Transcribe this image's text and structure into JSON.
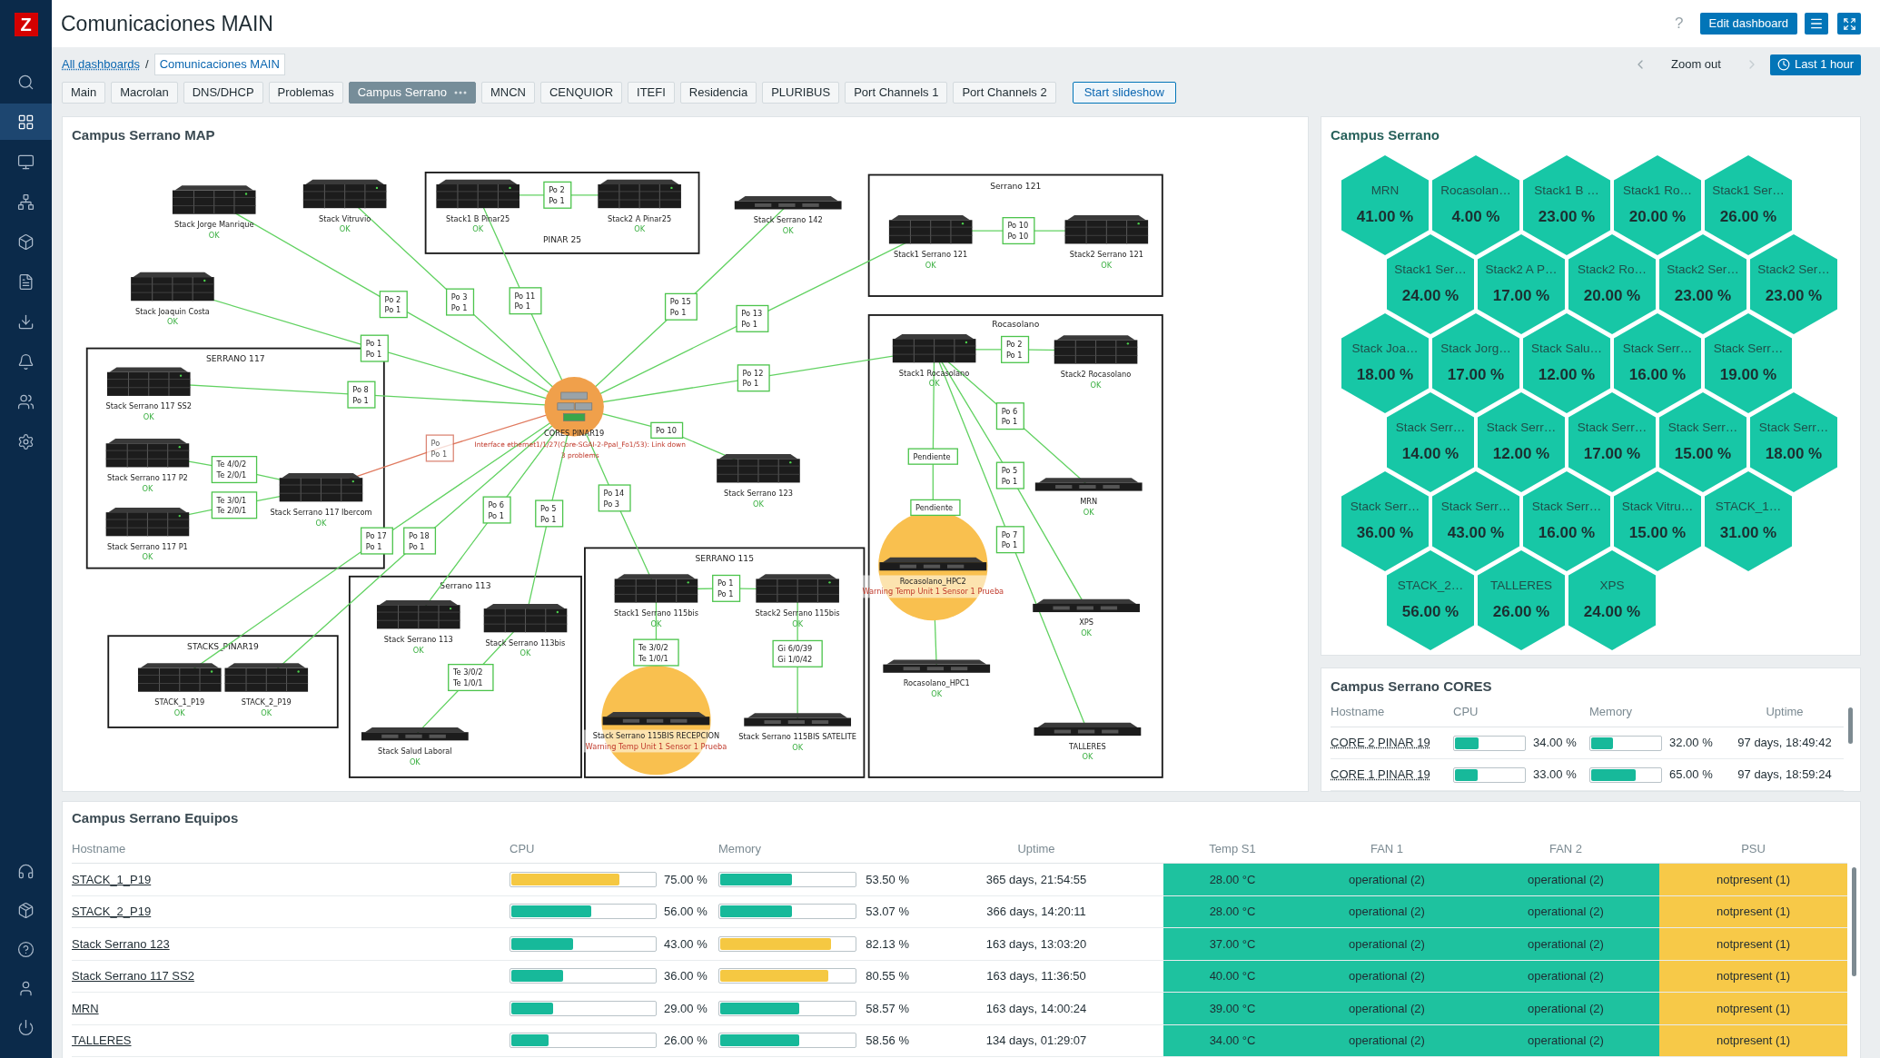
{
  "sidebar": {
    "logo": "Z",
    "items": [
      {
        "kind": "search",
        "selected": false
      },
      {
        "kind": "dashboards",
        "selected": true
      },
      {
        "kind": "monitoring",
        "selected": false
      },
      {
        "kind": "inventory",
        "selected": false
      },
      {
        "kind": "services",
        "selected": false
      },
      {
        "kind": "reports",
        "selected": false
      },
      {
        "kind": "data_collection",
        "selected": false
      },
      {
        "kind": "alerts",
        "selected": false
      },
      {
        "kind": "users",
        "selected": false
      },
      {
        "kind": "administration",
        "selected": false
      }
    ],
    "bottom_items": [
      {
        "kind": "support"
      },
      {
        "kind": "integrations"
      },
      {
        "kind": "help"
      },
      {
        "kind": "user"
      },
      {
        "kind": "sign_out"
      }
    ]
  },
  "header": {
    "title": "Comunicaciones MAIN",
    "help": "?",
    "edit_button": "Edit dashboard"
  },
  "breadcrumbs": {
    "items": [
      "All dashboards",
      "Comunicaciones MAIN"
    ],
    "separator": "/"
  },
  "time_controls": {
    "zoom_out": "Zoom out",
    "period": "Last 1 hour"
  },
  "tabs": [
    {
      "label": "Main",
      "selected": false
    },
    {
      "label": "Macrolan",
      "selected": false
    },
    {
      "label": "DNS/DHCP",
      "selected": false
    },
    {
      "label": "Problemas",
      "selected": false
    },
    {
      "label": "Campus Serrano",
      "selected": true
    },
    {
      "label": "MNCN",
      "selected": false
    },
    {
      "label": "CENQUIOR",
      "selected": false
    },
    {
      "label": "ITEFI",
      "selected": false
    },
    {
      "label": "Residencia",
      "selected": false
    },
    {
      "label": "PLURIBUS",
      "selected": false
    },
    {
      "label": "Port Channels 1",
      "selected": false
    },
    {
      "label": "Port Channels 2",
      "selected": false
    }
  ],
  "slideshow_button": "Start slideshow",
  "map": {
    "title": "Campus Serrano MAP",
    "groups": [
      "PINAR 25",
      "Serrano 121",
      "SERRANO 117",
      "Rocasolano",
      "SERRANO 115",
      "Serrano 113",
      "STACKS_PINAR19"
    ],
    "nodes": [
      {
        "kind": "stack",
        "label": "Stack Jorge Manrique",
        "status": [
          "OK"
        ],
        "problem": false
      },
      {
        "kind": "stack",
        "label": "Stack Vitruvio",
        "status": [
          "OK"
        ],
        "problem": false
      },
      {
        "kind": "stack",
        "label": "Stack Joaquin Costa",
        "status": [
          "OK"
        ],
        "problem": false
      },
      {
        "kind": "stack",
        "label": "Stack1 B Pinar25",
        "status": [
          "OK"
        ],
        "problem": false
      },
      {
        "kind": "stack",
        "label": "Stack2 A Pinar25",
        "status": [
          "OK"
        ],
        "problem": false
      },
      {
        "kind": "switch",
        "label": "Stack Serrano 142",
        "status": [
          "OK"
        ],
        "problem": false
      },
      {
        "kind": "stack",
        "label": "Stack1 Serrano 121",
        "status": [
          "OK"
        ],
        "problem": false
      },
      {
        "kind": "stack",
        "label": "Stack2 Serrano 121",
        "status": [
          "OK"
        ],
        "problem": false
      },
      {
        "kind": "stack",
        "label": "Stack Serrano 117 SS2",
        "status": [
          "OK"
        ],
        "problem": false
      },
      {
        "kind": "stack",
        "label": "Stack Serrano 117 P2",
        "status": [
          "OK"
        ],
        "problem": false
      },
      {
        "kind": "stack",
        "label": "Stack Serrano 117 P1",
        "status": [
          "OK"
        ],
        "problem": false
      },
      {
        "kind": "stack",
        "label": "Stack Serrano 117 Ibercom",
        "status": [
          "OK"
        ],
        "problem": false
      },
      {
        "kind": "core",
        "label": "CORES PINAR19",
        "status": [
          "Interface ethernet1/1/27(Core-SGAI-2-Ppal_Fo1/53): Link down",
          "3 problems"
        ],
        "problem": true
      },
      {
        "kind": "stack",
        "label": "Stack Serrano 123",
        "status": [
          "OK"
        ],
        "problem": false
      },
      {
        "kind": "stack",
        "label": "Stack1 Rocasolano",
        "status": [
          "OK"
        ],
        "problem": false
      },
      {
        "kind": "stack",
        "label": "Stack2 Rocasolano",
        "status": [
          "OK"
        ],
        "problem": false
      },
      {
        "kind": "switch",
        "label": "Rocasolano_HPC2",
        "status": [
          "Warning Temp Unit 1 Sensor 1 Prueba"
        ],
        "problem": true
      },
      {
        "kind": "switch",
        "label": "Rocasolano_HPC1",
        "status": [
          "OK"
        ],
        "problem": false
      },
      {
        "kind": "switch",
        "label": "MRN",
        "status": [
          "OK"
        ],
        "problem": false
      },
      {
        "kind": "switch",
        "label": "XPS",
        "status": [
          "OK"
        ],
        "problem": false
      },
      {
        "kind": "switch",
        "label": "TALLERES",
        "status": [
          "OK"
        ],
        "problem": false
      },
      {
        "kind": "stack",
        "label": "Stack1 Serrano 115bis",
        "status": [
          "OK"
        ],
        "problem": false
      },
      {
        "kind": "stack",
        "label": "Stack2 Serrano 115bis",
        "status": [
          "OK"
        ],
        "problem": false
      },
      {
        "kind": "switch",
        "label": "Stack Serrano 115BIS RECEPCION",
        "status": [
          "Warning Temp Unit 1 Sensor 1 Prueba"
        ],
        "problem": true
      },
      {
        "kind": "switch",
        "label": "Stack Serrano 115BIS SATELITE",
        "status": [
          "OK"
        ],
        "problem": false
      },
      {
        "kind": "stack",
        "label": "Stack Serrano 113",
        "status": [
          "OK"
        ],
        "problem": false
      },
      {
        "kind": "stack",
        "label": "Stack Serrano 113bis",
        "status": [
          "OK"
        ],
        "problem": false
      },
      {
        "kind": "switch",
        "label": "Stack Salud Laboral",
        "status": [
          "OK"
        ],
        "problem": false
      },
      {
        "kind": "stack",
        "label": "STACK_1_P19",
        "status": [
          "OK"
        ],
        "problem": false
      },
      {
        "kind": "stack",
        "label": "STACK_2_P19",
        "status": [
          "OK"
        ],
        "problem": false
      }
    ],
    "links": [
      {
        "labels": [
          "Po 2",
          "Po 1"
        ],
        "problem": false
      },
      {
        "labels": [
          "Po 10",
          "Po 10"
        ],
        "problem": false
      },
      {
        "labels": [
          "Te 4/0/2",
          "Te 2/0/1"
        ],
        "problem": false
      },
      {
        "labels": [
          "Te 3/0/1",
          "Te 2/0/1"
        ],
        "problem": false
      },
      {
        "labels": [
          "Po 2",
          "Po 1"
        ],
        "problem": false
      },
      {
        "labels": [
          "Po 3",
          "Po 1"
        ],
        "problem": false
      },
      {
        "labels": [
          "Po 11",
          "Po 1"
        ],
        "problem": false
      },
      {
        "labels": [
          "Po 15",
          "Po 1"
        ],
        "problem": false
      },
      {
        "labels": [
          "Po 13",
          "Po 1"
        ],
        "problem": false
      },
      {
        "labels": [
          "Po 1",
          "Po 1"
        ],
        "problem": false
      },
      {
        "labels": [
          "Po 8",
          "Po 1"
        ],
        "problem": false
      },
      {
        "labels": [
          "Po 12",
          "Po 1"
        ],
        "problem": false
      },
      {
        "labels": [
          "Po",
          "Po 1"
        ],
        "problem": true
      },
      {
        "labels": [
          "Po 10"
        ],
        "problem": false
      },
      {
        "labels": [
          "Po 14",
          "Po 3"
        ],
        "problem": false
      },
      {
        "labels": [
          "Po 6",
          "Po 1"
        ],
        "problem": false
      },
      {
        "labels": [
          "Po 5",
          "Po 1"
        ],
        "problem": false
      },
      {
        "labels": [
          "Po 17",
          "Po 1"
        ],
        "problem": false
      },
      {
        "labels": [
          "Po 18",
          "Po 1"
        ],
        "problem": false
      },
      {
        "labels": [
          "Po 2",
          "Po 1"
        ],
        "problem": false
      },
      {
        "labels": [
          "Pendiente"
        ],
        "second_labels": [
          "Pendiente"
        ],
        "problem": false
      },
      {
        "labels": [
          "Po 6",
          "Po 1"
        ],
        "problem": false
      },
      {
        "labels": [
          "Po 5",
          "Po 1"
        ],
        "problem": false
      },
      {
        "labels": [
          "Po 7",
          "Po 1"
        ],
        "problem": false
      },
      {
        "labels": [
          "Po 1",
          "Po 1"
        ],
        "problem": false
      },
      {
        "labels": [
          "Te 3/0/2",
          "Te 1/0/1"
        ],
        "problem": false
      },
      {
        "labels": [
          "Gi 6/0/39",
          "Gi 1/0/42"
        ],
        "problem": false
      },
      {
        "labels": [
          "Te 3/0/2",
          "Te 1/0/1"
        ],
        "problem": false
      },
      {
        "problem": false
      }
    ]
  },
  "honeycomb": {
    "title": "Campus Serrano",
    "cells": [
      {
        "name": "MRN",
        "value": "41.00 %"
      },
      {
        "name": "Rocasolan…",
        "value": "4.00 %"
      },
      {
        "name": "Stack1 B …",
        "value": "23.00 %"
      },
      {
        "name": "Stack1 Ro…",
        "value": "20.00 %"
      },
      {
        "name": "Stack1 Ser…",
        "value": "26.00 %"
      },
      {
        "name": "Stack1 Ser…",
        "value": "24.00 %"
      },
      {
        "name": "Stack2 A P…",
        "value": "17.00 %"
      },
      {
        "name": "Stack2 Ro…",
        "value": "20.00 %"
      },
      {
        "name": "Stack2 Ser…",
        "value": "23.00 %"
      },
      {
        "name": "Stack2 Ser…",
        "value": "23.00 %"
      },
      {
        "name": "Stack Joa…",
        "value": "18.00 %"
      },
      {
        "name": "Stack Jorg…",
        "value": "17.00 %"
      },
      {
        "name": "Stack Salu…",
        "value": "12.00 %"
      },
      {
        "name": "Stack Serr…",
        "value": "16.00 %"
      },
      {
        "name": "Stack Serr…",
        "value": "19.00 %"
      },
      {
        "name": "Stack Serr…",
        "value": "14.00 %"
      },
      {
        "name": "Stack Serr…",
        "value": "12.00 %"
      },
      {
        "name": "Stack Serr…",
        "value": "17.00 %"
      },
      {
        "name": "Stack Serr…",
        "value": "15.00 %"
      },
      {
        "name": "Stack Serr…",
        "value": "18.00 %"
      },
      {
        "name": "Stack Serr…",
        "value": "36.00 %"
      },
      {
        "name": "Stack Serr…",
        "value": "43.00 %"
      },
      {
        "name": "Stack Serr…",
        "value": "16.00 %"
      },
      {
        "name": "Stack Vitru…",
        "value": "15.00 %"
      },
      {
        "name": "STACK_1…",
        "value": "31.00 %"
      },
      {
        "name": "STACK_2…",
        "value": "56.00 %"
      },
      {
        "name": "TALLERES",
        "value": "26.00 %"
      },
      {
        "name": "XPS",
        "value": "24.00 %"
      }
    ]
  },
  "cores": {
    "title": "Campus Serrano CORES",
    "columns": [
      "Hostname",
      "CPU",
      "Memory",
      "Uptime"
    ],
    "rows": [
      {
        "hostname": "CORE 2 PINAR 19",
        "cpu": {
          "level": 0.34,
          "text": "34.00 %"
        },
        "memory": {
          "level": 0.32,
          "text": "32.00 %"
        },
        "uptime": "97 days, 18:49:42"
      },
      {
        "hostname": "CORE 1 PINAR 19",
        "cpu": {
          "level": 0.33,
          "text": "33.00 %"
        },
        "memory": {
          "level": 0.65,
          "text": "65.00 %"
        },
        "uptime": "97 days, 18:59:24"
      }
    ]
  },
  "equipos": {
    "title": "Campus Serrano Equipos",
    "columns": [
      "Hostname",
      "CPU",
      "Memory",
      "Uptime",
      "Temp S1",
      "FAN 1",
      "FAN 2",
      "PSU"
    ],
    "rows": [
      {
        "hostname": "STACK_1_P19",
        "cpu": {
          "level": 0.75,
          "text": "75.00 %"
        },
        "memory": {
          "level": 0.535,
          "text": "53.50 %"
        },
        "uptime": "365 days, 21:54:55",
        "temp": {
          "text": "28.00 °C",
          "warning": false
        },
        "fan1": {
          "text": "operational (2)",
          "warning": false
        },
        "fan2": {
          "text": "operational (2)",
          "warning": false
        },
        "psu": {
          "text": "notpresent (1)",
          "warning": true
        }
      },
      {
        "hostname": "STACK_2_P19",
        "cpu": {
          "level": 0.56,
          "text": "56.00 %"
        },
        "memory": {
          "level": 0.5307,
          "text": "53.07 %"
        },
        "uptime": "366 days, 14:20:11",
        "temp": {
          "text": "28.00 °C",
          "warning": false
        },
        "fan1": {
          "text": "operational (2)",
          "warning": false
        },
        "fan2": {
          "text": "operational (2)",
          "warning": false
        },
        "psu": {
          "text": "notpresent (1)",
          "warning": true
        }
      },
      {
        "hostname": "Stack Serrano 123",
        "cpu": {
          "level": 0.43,
          "text": "43.00 %"
        },
        "memory": {
          "level": 0.8213,
          "text": "82.13 %"
        },
        "uptime": "163 days, 13:03:20",
        "temp": {
          "text": "37.00 °C",
          "warning": false
        },
        "fan1": {
          "text": "operational (2)",
          "warning": false
        },
        "fan2": {
          "text": "operational (2)",
          "warning": false
        },
        "psu": {
          "text": "notpresent (1)",
          "warning": true
        }
      },
      {
        "hostname": "Stack Serrano 117 SS2",
        "cpu": {
          "level": 0.36,
          "text": "36.00 %"
        },
        "memory": {
          "level": 0.8055,
          "text": "80.55 %"
        },
        "uptime": "163 days, 11:36:50",
        "temp": {
          "text": "40.00 °C",
          "warning": false
        },
        "fan1": {
          "text": "operational (2)",
          "warning": false
        },
        "fan2": {
          "text": "operational (2)",
          "warning": false
        },
        "psu": {
          "text": "notpresent (1)",
          "warning": true
        }
      },
      {
        "hostname": "MRN",
        "cpu": {
          "level": 0.29,
          "text": "29.00 %"
        },
        "memory": {
          "level": 0.5857,
          "text": "58.57 %"
        },
        "uptime": "163 days, 14:00:24",
        "temp": {
          "text": "39.00 °C",
          "warning": false
        },
        "fan1": {
          "text": "operational (2)",
          "warning": false
        },
        "fan2": {
          "text": "operational (2)",
          "warning": false
        },
        "psu": {
          "text": "notpresent (1)",
          "warning": true
        }
      },
      {
        "hostname": "TALLERES",
        "cpu": {
          "level": 0.26,
          "text": "26.00 %"
        },
        "memory": {
          "level": 0.5856,
          "text": "58.56 %"
        },
        "uptime": "134 days, 01:29:07",
        "temp": {
          "text": "34.00 °C",
          "warning": false
        },
        "fan1": {
          "text": "operational (2)",
          "warning": false
        },
        "fan2": {
          "text": "operational (2)",
          "warning": false
        },
        "psu": {
          "text": "notpresent (1)",
          "warning": true
        }
      }
    ]
  }
}
